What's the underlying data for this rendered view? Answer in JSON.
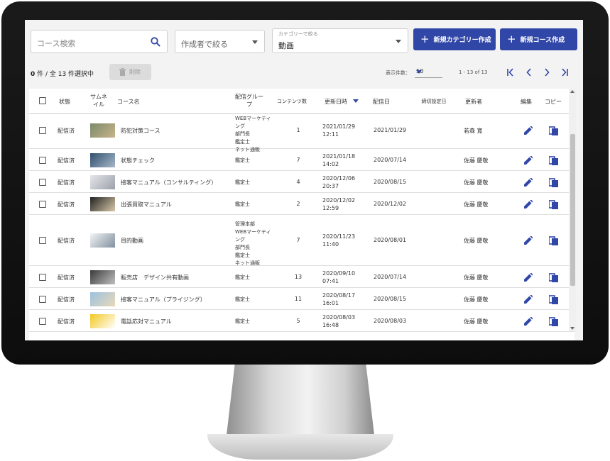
{
  "toolbar": {
    "search_placeholder": "コース検索",
    "author_filter": "作成者で絞る",
    "category_label": "カテゴリーで絞る",
    "category_value": "動画",
    "new_category_button": "新規カテゴリー作成",
    "new_course_button": "新規コース作成"
  },
  "selection": {
    "selected": "0",
    "text": " 件 / 全 13 件選択中",
    "delete_button": "削除"
  },
  "pagination": {
    "per_page_label": "表示件数：",
    "per_page_value": "50",
    "range": "1 - 13 of 13"
  },
  "table": {
    "headers": {
      "status": "状態",
      "thumbnail": "サムネイル",
      "name": "コース名",
      "group": "配信グループ",
      "contents": "コンテンツ数",
      "updated": "更新日時",
      "delivery": "配信日",
      "deadline": "締切設定日",
      "updater": "更新者",
      "edit": "編集",
      "copy": "コピー"
    },
    "rows": [
      {
        "status": "配信済",
        "name": "防犯対策コース",
        "group": "WEBマーケティング\n部門長\n鑑定士\nネット通販",
        "count": "1",
        "updated": "2021/01/29\n12:11",
        "delivered": "2021/01/29",
        "updater": "若森 寛"
      },
      {
        "status": "配信済",
        "name": "状態チェック",
        "group": "鑑定士",
        "count": "7",
        "updated": "2021/01/18\n14:02",
        "delivered": "2020/07/14",
        "updater": "佐藤 慶敬"
      },
      {
        "status": "配信済",
        "name": "接客マニュアル（コンサルティング）",
        "group": "鑑定士",
        "count": "4",
        "updated": "2020/12/06\n20:37",
        "delivered": "2020/08/15",
        "updater": "佐藤 慶敬"
      },
      {
        "status": "配信済",
        "name": "出張買取マニュアル",
        "group": "鑑定士",
        "count": "2",
        "updated": "2020/12/02\n12:59",
        "delivered": "2020/12/02",
        "updater": "佐藤 慶敬"
      },
      {
        "status": "配信済",
        "name": "目的動画",
        "group": "管理本部\nWEBマーケティング\n部門長\n鑑定士\nネット通販",
        "count": "7",
        "updated": "2020/11/23\n11:40",
        "delivered": "2020/08/01",
        "updater": "佐藤 慶敬"
      },
      {
        "status": "配信済",
        "name": "販売店　デザイン共有動画",
        "group": "鑑定士",
        "count": "13",
        "updated": "2020/09/10\n07:41",
        "delivered": "2020/07/14",
        "updater": "佐藤 慶敬"
      },
      {
        "status": "配信済",
        "name": "接客マニュアル（プライジング）",
        "group": "鑑定士",
        "count": "11",
        "updated": "2020/08/17\n16:01",
        "delivered": "2020/08/15",
        "updater": "佐藤 慶敬"
      },
      {
        "status": "配信済",
        "name": "電話応対マニュアル",
        "group": "鑑定士",
        "count": "5",
        "updated": "2020/08/03\n16:48",
        "delivered": "2020/08/03",
        "updater": "佐藤 慶敬"
      }
    ]
  },
  "colors": {
    "accent": "#3147a8",
    "bezel": "#111111",
    "screen_bg": "#f3f3f3"
  }
}
